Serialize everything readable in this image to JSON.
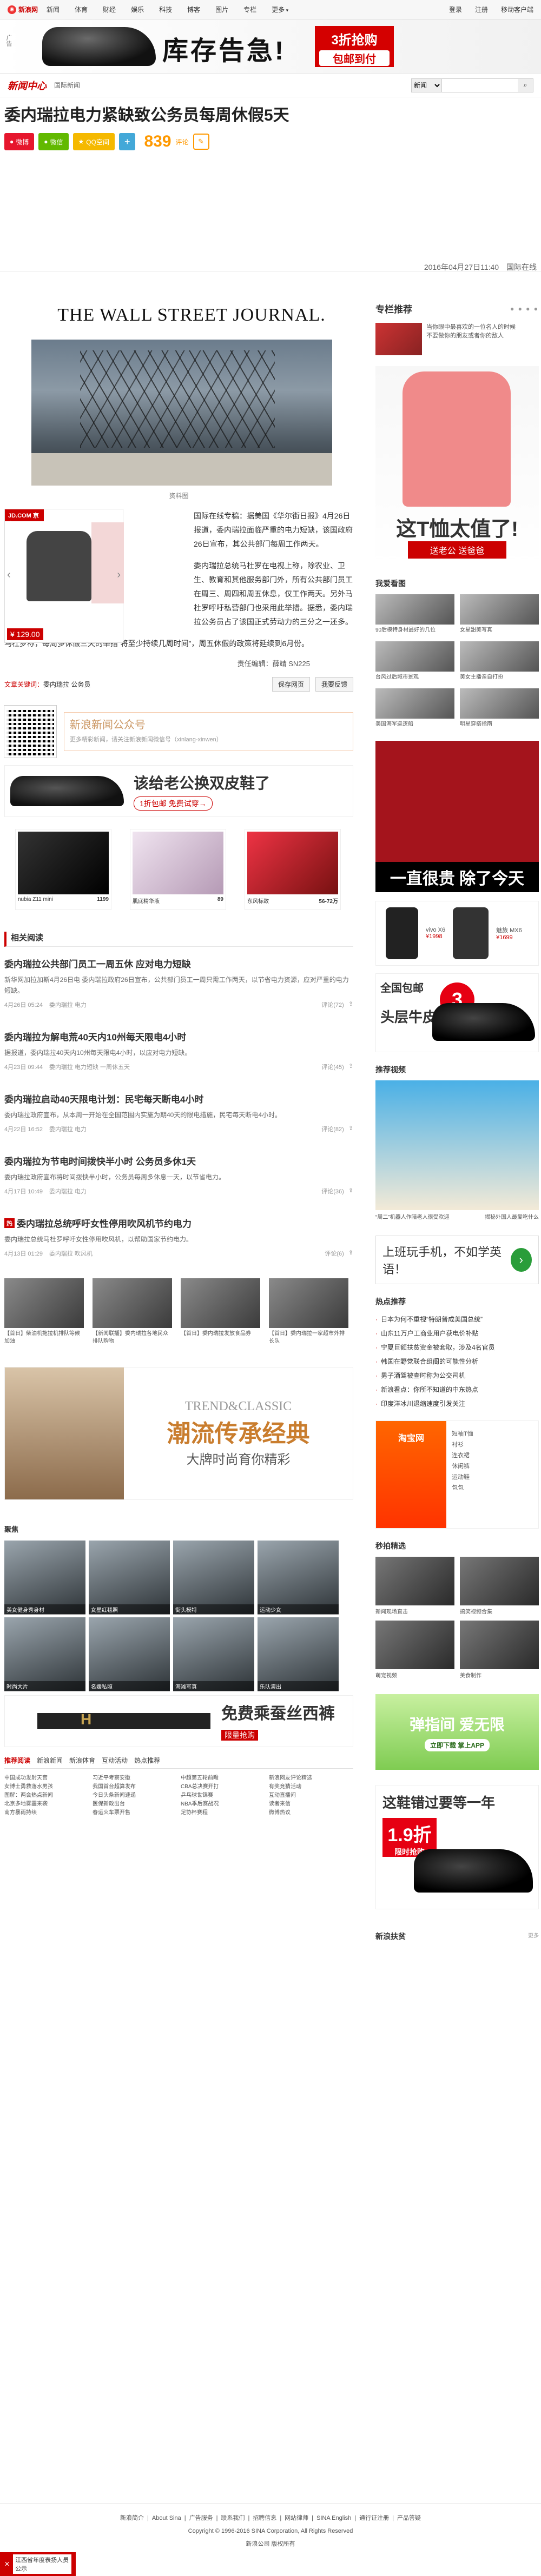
{
  "topnav": {
    "logo": "新浪网",
    "items": [
      "新闻",
      "体育",
      "财经",
      "娱乐",
      "科技",
      "博客",
      "图片",
      "专栏",
      "更多"
    ],
    "right": [
      "登录",
      "注册",
      "移动客户端"
    ]
  },
  "banner": {
    "side_text": "广告",
    "headline": "库存告急!",
    "tag_top": "3折抢购",
    "tag_bottom": "包邮到付"
  },
  "channel": {
    "brand": "新闻中心",
    "crumb": "国际新闻",
    "search_scope": "新闻",
    "search_placeholder": ""
  },
  "article": {
    "title": "委内瑞拉电力紧缺致公务员每周休假5天",
    "share": [
      {
        "label": "微博",
        "color": "#e6162d"
      },
      {
        "label": "微信",
        "color": "#62b900"
      },
      {
        "label": "QQ空间",
        "color": "#f5b900"
      },
      {
        "label": "+",
        "color": "#43a8d8"
      }
    ],
    "comment_count": "839",
    "comment_label": "评论",
    "date": "2016年04月27日11:40",
    "source": "国际在线",
    "wsj": "THE WALL STREET JOURNAL.",
    "photo_caption": "资料图",
    "ad_jd": "JD.COM 京东",
    "ad_price": "¥ 129.00",
    "p1": "国际在线专稿：据美国《华尔街日报》4月26日报道，委内瑞拉面临严重的电力短缺，该国政府26日宣布，其公共部门每周工作两天。",
    "p2": "委内瑞拉总统马杜罗在电视上称，除农业、卫生、教育和其他服务部门外，所有公共部门员工在周三、周四和周五休息，仅工作两天。另外马杜罗呼吁私营部门也采用此举措。据悉，委内瑞拉公务员占了该国正式劳动力的三分之一还多。",
    "p3": "马杜罗称，每周多休假三天的举措“将至少持续几周时间”，周五休假的政策将延续到6月份。",
    "editor": "责任编辑：薛靖 SN225",
    "tags_label": "文章关键词：",
    "tags": "委内瑞拉 公务员",
    "save": "我要反馈",
    "print": "保存网页",
    "wechat_title": "新浪新闻公众号",
    "wechat_sub": "更多精彩新闻，请关注新浪新闻微信号（xinlang-xinwen）",
    "shoe_ad_title": "该给老公换双皮鞋了",
    "shoe_ad_sub": "1折包邮 免费试穿→",
    "products": [
      {
        "name": "nubia Z11 mini",
        "price": "1199"
      },
      {
        "name": "肌底精华液",
        "price": "89"
      },
      {
        "name": "东风标致",
        "price": "56-72万"
      }
    ]
  },
  "related": {
    "header": "相关阅读",
    "items": [
      {
        "title": "委内瑞拉公共部门员工一周五休 应对电力短缺",
        "desc": "新华网加拉加斯4月26日电 委内瑞拉政府26日宣布，公共部门员工一周只需工作两天，以节省电力资源，应对严重的电力短缺。",
        "date": "4月26日 05:24",
        "tags": "委内瑞拉 电力",
        "comments": "评论(72)",
        "hot": false
      },
      {
        "title": "委内瑞拉为解电荒40天内10州每天限电4小时",
        "desc": "据报道，委内瑞拉40天内10州每天限电4小时，以应对电力短缺。",
        "date": "4月23日 09:44",
        "tags": "委内瑞拉 电力短缺 一周休五天",
        "comments": "评论(45)",
        "hot": false
      },
      {
        "title": "委内瑞拉启动40天限电计划：民宅每天断电4小时",
        "desc": "委内瑞拉政府宣布，从本周一开始在全国范围内实施为期40天的限电措施，民宅每天断电4小时。",
        "date": "4月22日 16:52",
        "tags": "委内瑞拉 电力",
        "comments": "评论(82)",
        "hot": false
      },
      {
        "title": "委内瑞拉为节电时间拨快半小时 公务员多休1天",
        "desc": "委内瑞拉政府宣布将时间拨快半小时，公务员每周多休息一天，以节省电力。",
        "date": "4月17日 10:49",
        "tags": "委内瑞拉 电力",
        "comments": "评论(36)",
        "hot": false
      },
      {
        "title": "委内瑞拉总统呼吁女性停用吹风机节约电力",
        "desc": "委内瑞拉总统马杜罗呼吁女性停用吹风机，以帮助国家节约电力。",
        "date": "4月13日 01:29",
        "tags": "委内瑞拉 吹风机",
        "comments": "评论(6)",
        "hot": true
      }
    ],
    "thumbs": [
      "【首日】柴油机拖拉机排队等候加油",
      "【新闻联播】委内瑞拉各地民众排队购物",
      "【首日】委内瑞拉发放食品券",
      "【首日】委内瑞拉一家超市外排长队"
    ]
  },
  "bigad": {
    "en": "TREND&CLASSIC",
    "zh": "潮流传承经典",
    "zh2": "大牌时尚育你精彩"
  },
  "gallery": {
    "header": "聚焦",
    "items": [
      "美女健身秀身材",
      "女星红毯照",
      "街头模特",
      "运动少女",
      "时尚大片",
      "名媛私照",
      "海滩写真",
      "乐队演出"
    ]
  },
  "belt_ad": {
    "title": "免费乘蚕丝西裤",
    "sub": "限量抢购"
  },
  "bottom": {
    "tabs": [
      "推荐阅读",
      "新浪新闻",
      "新浪体育",
      "互动活动",
      "热点推荐"
    ],
    "cols": [
      [
        "中国成功发射天宫",
        "女博士勇救落水男孩",
        "图解：两会热点新闻",
        "北京多地雾霾来袭",
        "南方暴雨持续"
      ],
      [
        "习近平考察安徽",
        "我国首台超算发布",
        "今日头条新闻速递",
        "医保新政出台",
        "春运火车票开售"
      ],
      [
        "中超第五轮前瞻",
        "CBA总决赛开打",
        "乒乓球世锦赛",
        "NBA季后赛战况",
        "足协杯赛程"
      ],
      [
        "新浪网友评论精选",
        "有奖竞猜活动",
        "互动直播间",
        "读者来信",
        "微博热议"
      ]
    ]
  },
  "side": {
    "recommend": "专栏推荐",
    "hot_title": "当你眼中最喜欢的一位名人的时候",
    "hot_sub": "不要做你的朋友或者你的敌人",
    "polo_title": "这T恤太值了!",
    "polo_sub": "送老公 送爸爸",
    "recommend2": "我爱看图",
    "grid": [
      "90后模特身材最好的几位",
      "女星甜美写真",
      "台风过后城市景观",
      "美女主播亲自打扮",
      "美国海军巡逻船",
      "明星穿搭指南",
      "趣闻趣事",
      "萌宠日常"
    ],
    "redshirt": "一直很贵 除了今天",
    "phone_name": "vivo X6",
    "phone_price": "¥1998",
    "phone_name2": "魅族 MX6",
    "phone_price2": "¥1699",
    "shoe2_top": "全国包邮",
    "shoe2_badge": "3",
    "shoe2_big": "头层牛皮",
    "video_title": "推荐视频",
    "video_caps": [
      "“周二”机器人作陪老人很受欢迎",
      "揭秘外国人最爱吃什么"
    ],
    "boxad_text": "上班玩手机，不如学英语！",
    "hot_title2": "热点推荐",
    "hotlist": [
      "日本为何不重视“特朗普成美国总统”",
      "山东11万户工商业用户获电价补贴",
      "宁夏巨额扶贫资金被套取，涉及4名官员",
      "韩国在野党联合组阁的可能性分析",
      "男子酒驾被查时称为公交司机",
      "新浪看点：你所不知道的中东热点",
      "印度洋冰川退缩速度引发关注"
    ],
    "taobao_title": "淘宝网",
    "taobao_items": [
      "短袖T恤",
      "衬衫",
      "连衣裙",
      "休闲裤",
      "运动鞋",
      "包包"
    ],
    "sec_title": "秒拍精选",
    "sec_items": [
      "新闻现场直击",
      "搞笑视频合集",
      "萌宠视频",
      "美食制作"
    ],
    "green_title": "弹指间 爱无限",
    "green_sub": "立即下载 掌上APP",
    "shoe3_t": "这鞋错过要等一年",
    "shoe3_badge": "1.9折",
    "shoe3_badge_sub": "限时抢购",
    "newslist": "新浪扶贫",
    "newslist_r": "更多"
  },
  "footer": {
    "links": [
      "新浪简介",
      "About Sina",
      "广告服务",
      "联系我们",
      "招聘信息",
      "网站律师",
      "SINA English",
      "通行证注册",
      "产品答疑"
    ],
    "copy": "Copyright © 1996-2016 SINA Corporation, All Rights Reserved",
    "company": "新浪公司 版权所有",
    "float_label": "江西省年度表扬人员公示"
  }
}
